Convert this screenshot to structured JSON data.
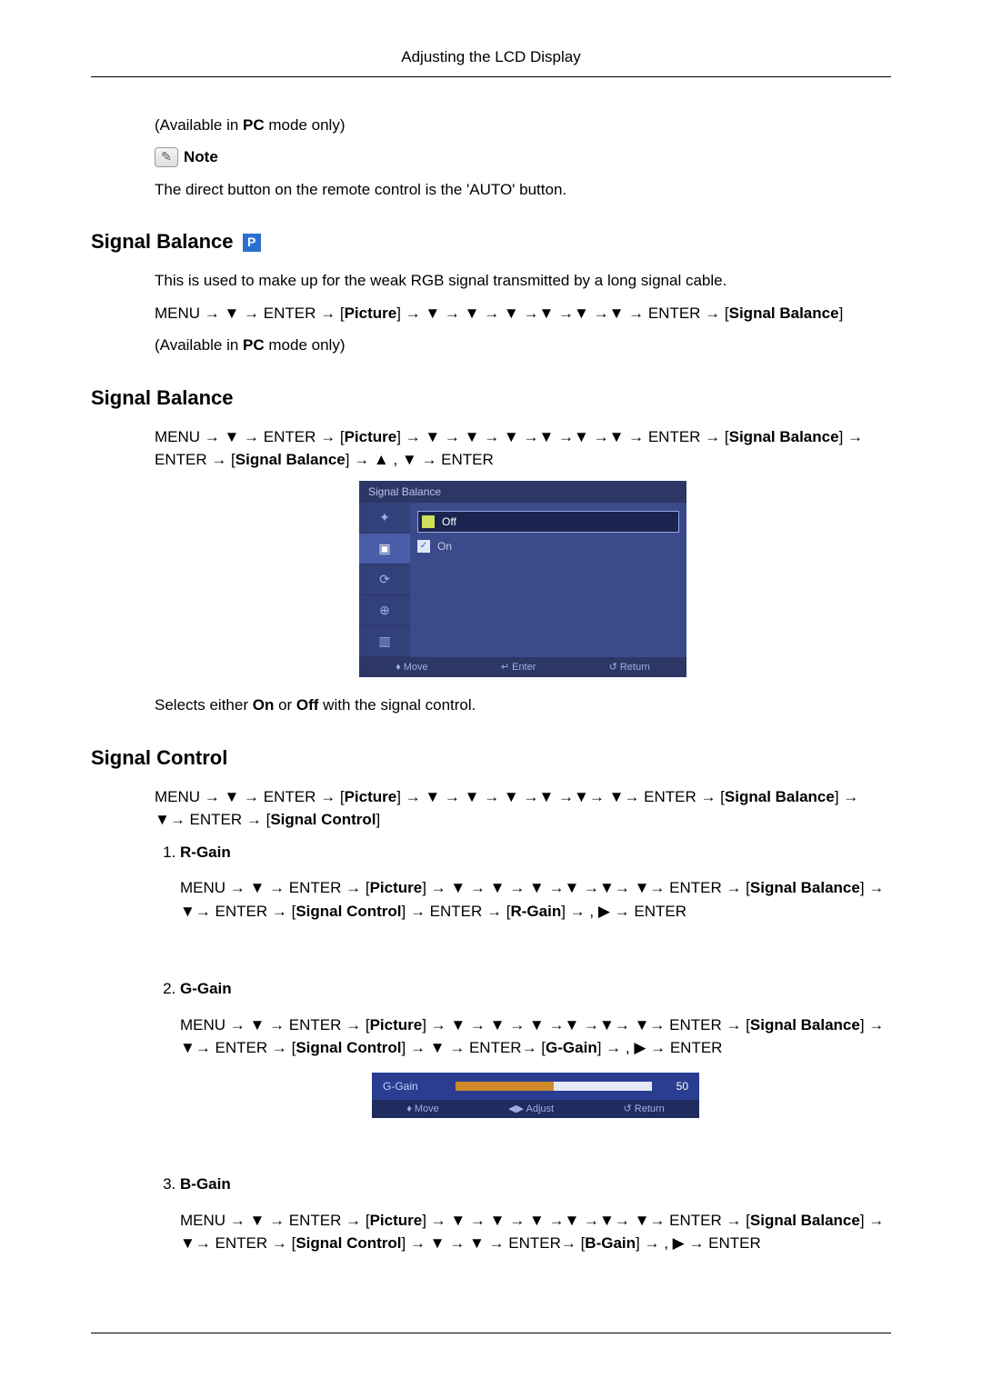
{
  "header": {
    "title": "Adjusting the LCD Display"
  },
  "intro": {
    "available": "(Available in PC mode only)",
    "note_label": "Note",
    "note_text": "The direct button on the remote control is the 'AUTO' button."
  },
  "sec1": {
    "heading": "Signal Balance",
    "desc": "This is used to make up for the weak RGB signal transmitted by a long signal cable.",
    "nav_pre": "MENU → ▼ → ENTER → [",
    "nav_pic": "Picture",
    "nav_mid": "] → ▼ → ▼ → ▼ →▼ →▼ →▼ → ENTER → [",
    "nav_end_label": "Signal Balance",
    "nav_end": "]",
    "available": "(Available in PC mode only)"
  },
  "sec2": {
    "heading": "Signal Balance",
    "nav_pre": "MENU → ▼ → ENTER → [",
    "nav_pic": "Picture",
    "nav_mid": "] → ▼ → ▼ → ▼ →▼ →▼ →▼ → ENTER → [",
    "nav_sb": "Signal Balance",
    "nav_after_sb": "] → ENTER → [",
    "nav_sb2": "Signal Balance",
    "nav_tail": "] → ▲ , ▼ → ENTER",
    "panel": {
      "title": "Signal Balance",
      "opt_off": "Off",
      "opt_on": "On",
      "side_icons": [
        "✦",
        "▣",
        "⟳",
        "⊕",
        "▥"
      ],
      "footer_move": "♦ Move",
      "footer_enter": "↵ Enter",
      "footer_return": "↺ Return"
    },
    "selects_text_pre": "Selects either ",
    "on": "On",
    "or": " or ",
    "off": "Off",
    "selects_text_post": " with the signal control."
  },
  "sec3": {
    "heading": "Signal Control",
    "nav_pre": "MENU → ▼ → ENTER → [",
    "nav_pic": "Picture",
    "nav_mid": "] → ▼ → ▼ → ▼ →▼ →▼→ ▼→ ENTER → [",
    "nav_sb": "Signal Balance",
    "nav_after_sb": "] → ▼→ ENTER → [",
    "nav_sc": "Signal Control",
    "nav_end": "]",
    "items": [
      {
        "title": "R-Gain",
        "nav_pre": "MENU → ▼ → ENTER → [",
        "pic": "Picture",
        "mid1": "] → ▼ → ▼ → ▼ →▼ →▼→ ▼→ ENTER → [",
        "sb": "Signal Balance",
        "mid2": "] → ▼→ ENTER → [",
        "sc": "Signal Control",
        "mid3": "] → ENTER → [",
        "gain": "R-Gain",
        "tail": "] →   , ▶ → ENTER"
      },
      {
        "title": "G-Gain",
        "nav_pre": "MENU → ▼ → ENTER → [",
        "pic": "Picture",
        "mid1": "] → ▼ → ▼ → ▼ →▼ →▼→ ▼→ ENTER → [",
        "sb": "Signal Balance",
        "mid2": "] → ▼→ ENTER → [",
        "sc": "Signal Control",
        "mid3": "] → ▼ → ENTER→ [",
        "gain": "G-Gain",
        "tail": "] →   , ▶ → ENTER",
        "panel": {
          "label": "G-Gain",
          "value": "50",
          "footer_move": "♦ Move",
          "footer_adjust": "◀▶ Adjust",
          "footer_return": "↺ Return"
        }
      },
      {
        "title": "B-Gain",
        "nav_pre": "MENU → ▼ → ENTER → [",
        "pic": "Picture",
        "mid1": "] → ▼ → ▼ → ▼ →▼ →▼→ ▼→ ENTER → [",
        "sb": "Signal Balance",
        "mid2": "] → ▼→ ENTER → [",
        "sc": "Signal Control",
        "mid3": "] → ▼ → ▼ → ENTER→ [",
        "gain": "B-Gain",
        "tail": "] →   , ▶ → ENTER"
      }
    ]
  }
}
